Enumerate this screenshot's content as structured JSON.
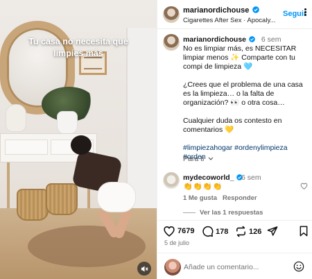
{
  "media": {
    "caption_overlay": "Tu casa no necesita que limpies más",
    "mute_icon": "speaker-muted-icon"
  },
  "header": {
    "username": "marianordichouse",
    "verified_icon": "verified-badge-icon",
    "audio": "Cigarettes After Sex · Apocaly...",
    "follow_label": "Seguir",
    "more_icon": "more-options-icon"
  },
  "post": {
    "username": "marianordichouse",
    "time": "6 sem",
    "paragraph1": "No es limpiar más, es NECESITAR limpiar menos ✨ Comparte con tu compi de limpieza 🩵",
    "paragraph2": "¿Crees que el problema de una casa es la limpieza… o la falta de organización? 👀 o otra cosa…",
    "paragraph3": "Cualquier duda os contesto en comentarios 💛",
    "hashtags": "#limpiezahogar #ordenylimpieza #orden",
    "see_translation": "Para ti"
  },
  "comment": {
    "username": "mydecoworld_",
    "time": "6 sem",
    "text": "👏👏👏👏",
    "likes_label": "1 Me gusta",
    "reply_label": "Responder",
    "view_replies": "Ver las 1 respuestas"
  },
  "actions": {
    "likes": "7679",
    "comments": "178",
    "reposts": "126",
    "icons": [
      "heart-icon",
      "comment-icon",
      "repost-icon",
      "share-icon",
      "bookmark-icon"
    ]
  },
  "date": "5 de julio",
  "add_comment": {
    "placeholder": "Añade un comentario...",
    "emoji_icon": "emoji-icon"
  },
  "colors": {
    "follow": "#0095f6",
    "hashtag": "#00376b",
    "verified": "#0095f6"
  }
}
